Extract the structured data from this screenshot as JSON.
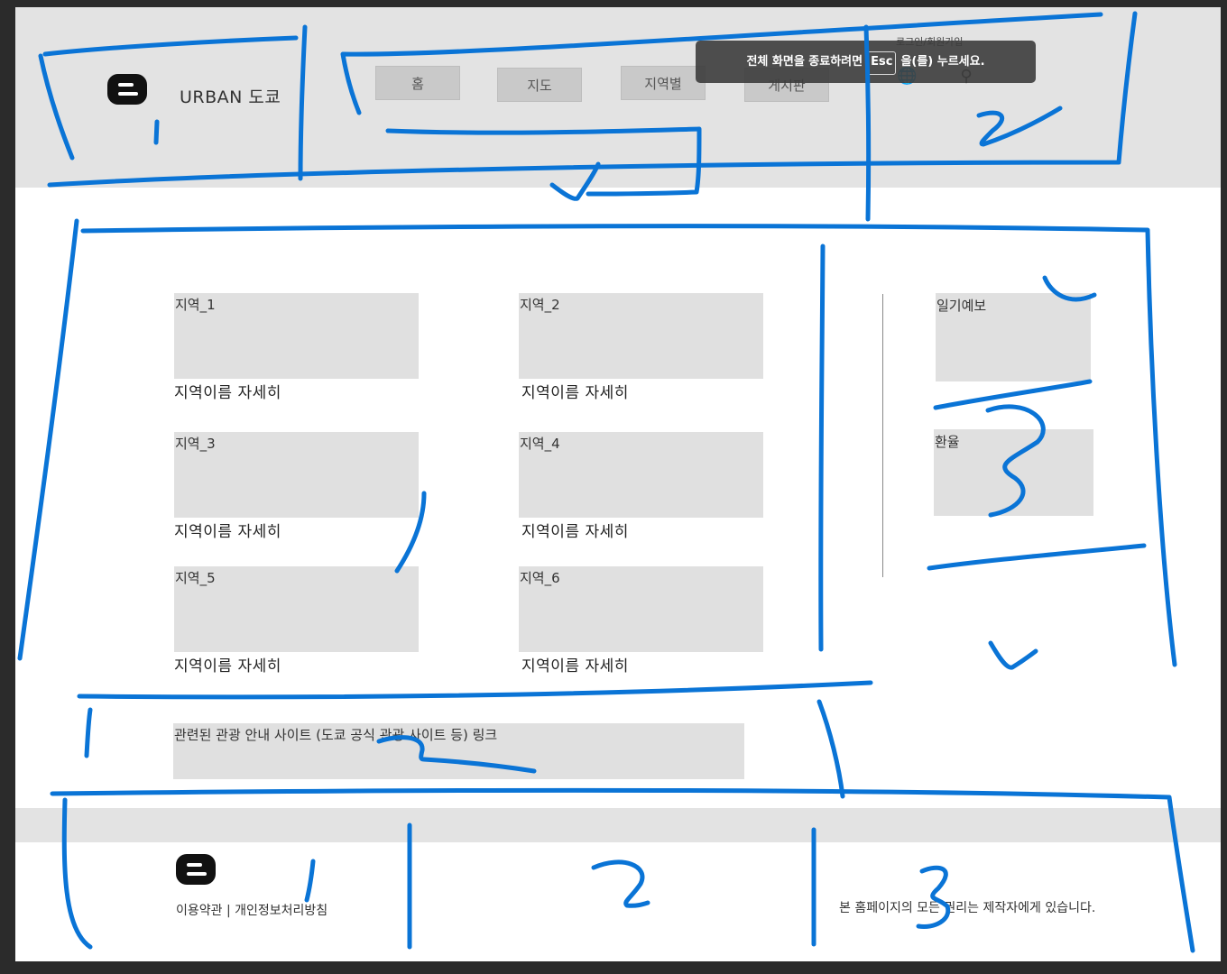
{
  "header": {
    "brand": "URBAN 도쿄",
    "nav": [
      "홈",
      "지도",
      "지역별",
      "게시판"
    ],
    "top_links": "로그인/회원가입",
    "icons": [
      "globe-icon",
      "search-icon"
    ]
  },
  "toast": {
    "before": "전체 화면을 종료하려면",
    "key": "Esc",
    "after": "을(를) 누르세요."
  },
  "regions": [
    {
      "title": "지역_1",
      "caption": "지역이름 자세히"
    },
    {
      "title": "지역_2",
      "caption": "지역이름 자세히"
    },
    {
      "title": "지역_3",
      "caption": "지역이름 자세히"
    },
    {
      "title": "지역_4",
      "caption": "지역이름 자세히"
    },
    {
      "title": "지역_5",
      "caption": "지역이름 자세히"
    },
    {
      "title": "지역_6",
      "caption": "지역이름 자세히"
    }
  ],
  "sidebar": {
    "weather": "일기예보",
    "exchange": "환율"
  },
  "links_box": "관련된 관광 안내 사이트 (도쿄 공식 관광 사이트 등) 링크",
  "footer": {
    "links": "이용약관 | 개인정보처리방침",
    "copyright": "본 홈페이지의 모든 권리는 제작자에게 있습니다."
  },
  "annotations": [
    "1",
    "2",
    "3",
    "1",
    "2",
    "3",
    "1",
    "2",
    "3"
  ],
  "colors": {
    "sketch": "#0a74d6",
    "panel": "#e0e0e0",
    "header": "#e3e3e3"
  }
}
